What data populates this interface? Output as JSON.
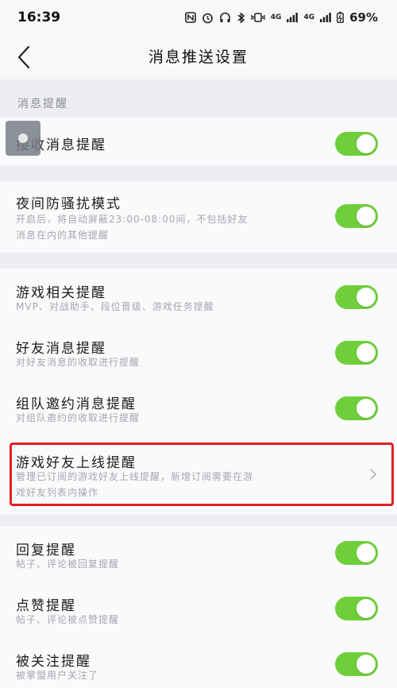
{
  "status_bar": {
    "time": "16:39",
    "icons": [
      "nfc-icon",
      "alarm-icon",
      "headset-icon",
      "bluetooth-icon",
      "vibrate-icon"
    ],
    "network1": "4G",
    "network2": "4G",
    "battery": "69%"
  },
  "header": {
    "title": "消息推送设置"
  },
  "sections": {
    "message_header": "消息提醒"
  },
  "items": {
    "receive": {
      "title": "接收消息提醒"
    },
    "night": {
      "title": "夜间防骚扰模式",
      "desc": "开启后，将自动屏蔽23:00-08:00间，不包括好友消息在内的其他提醒"
    },
    "game": {
      "title": "游戏相关提醒",
      "desc": "MVP、对战助手、段位晋级、游戏任务提醒"
    },
    "friend_msg": {
      "title": "好友消息提醒",
      "desc": "对好友消息的收取进行提醒"
    },
    "team": {
      "title": "组队邀约消息提醒",
      "desc": "对组队邀约的收取进行提醒"
    },
    "friend_online": {
      "title": "游戏好友上线提醒",
      "desc": "管理已订阅的游戏好友上线提醒，新增订阅需要在游戏好友列表内操作"
    },
    "reply": {
      "title": "回复提醒",
      "desc": "帖子、评论被回复提醒"
    },
    "like": {
      "title": "点赞提醒",
      "desc": "帖子、评论被点赞提醒"
    },
    "follow": {
      "title": "被关注提醒",
      "desc": "被掌盟用户关注了"
    }
  },
  "colors": {
    "toggle_on": "#6fcf3a",
    "highlight": "#e3201f",
    "background": "#eceef2",
    "card": "#f9fafb"
  }
}
